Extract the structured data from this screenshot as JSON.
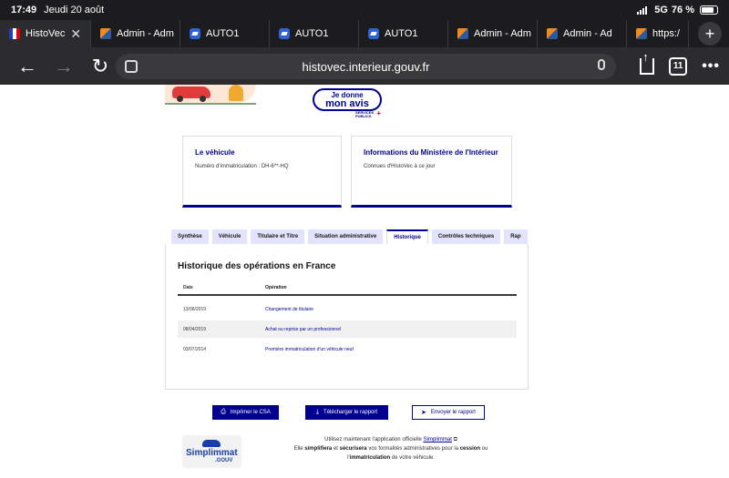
{
  "status_bar": {
    "time": "17:49",
    "date": "Jeudi 20 août",
    "network": "5G",
    "battery": "76 %"
  },
  "browser_tabs": [
    {
      "title": "HistoVec",
      "active": true,
      "favicon": "flag-fr"
    },
    {
      "title": "Admin - Adm",
      "favicon": "admin-icon"
    },
    {
      "title": "AUTO1",
      "favicon": "auto1-icon"
    },
    {
      "title": "AUTO1",
      "favicon": "auto1-icon"
    },
    {
      "title": "AUTO1",
      "favicon": "auto1-icon"
    },
    {
      "title": "Admin - Adm",
      "favicon": "admin-icon"
    },
    {
      "title": "Admin - Ad",
      "favicon": "admin-icon"
    },
    {
      "title": "https:/",
      "favicon": "admin-icon"
    }
  ],
  "toolbar": {
    "url": "histovec.interieur.gouv.fr",
    "tab_count": "11"
  },
  "feedback": {
    "line1": "Je donne",
    "line2": "mon avis",
    "services_publics": "SERVICES PUBLICS"
  },
  "cards": {
    "vehicle": {
      "title": "Le véhicule",
      "text": "Numéro d'immatriculation : DH-6**-HQ"
    },
    "ministry": {
      "title": "Informations du Ministère de l'Intérieur",
      "text": "Connues d'HistoVec à ce jour"
    }
  },
  "page_tabs": [
    {
      "label": "Synthèse"
    },
    {
      "label": "Véhicule"
    },
    {
      "label": "Titulaire et Titre"
    },
    {
      "label": "Situation administrative"
    },
    {
      "label": "Historique",
      "active": true
    },
    {
      "label": "Contrôles techniques"
    },
    {
      "label": "Rap"
    }
  ],
  "history": {
    "title": "Historique des opérations en France",
    "headers": {
      "date": "Date",
      "operation": "Opération"
    },
    "rows": [
      {
        "date": "13/06/2019",
        "operation": "Changement de titulaire"
      },
      {
        "date": "08/04/2019",
        "operation": "Achat ou reprise par un professionnel"
      },
      {
        "date": "03/07/2014",
        "operation": "Première immatriculation d'un véhicule neuf"
      }
    ]
  },
  "actions": {
    "print": "Imprimer le CSA",
    "download": "Télécharger le rapport",
    "send": "Envoyer le rapport"
  },
  "simplimmat": {
    "logo_main": "Simplimmat",
    "logo_sub": ".GOUV",
    "text_intro": "Utilisez maintenant l'application officielle",
    "app_name": "Simplimmat",
    "text_she": "Elle",
    "simplify": "simplifiera",
    "and": "et",
    "secure": "sécurisera",
    "text_procedures": "vos formalités administratives pour la",
    "sale": "cession",
    "or": "ou",
    "the": "l'",
    "registration": "immatriculation",
    "text_end": "de votre véhicule."
  },
  "colors": {
    "accent": "#000091",
    "tab_bg": "#e3e3fd",
    "chrome": "#2c2c2e"
  }
}
